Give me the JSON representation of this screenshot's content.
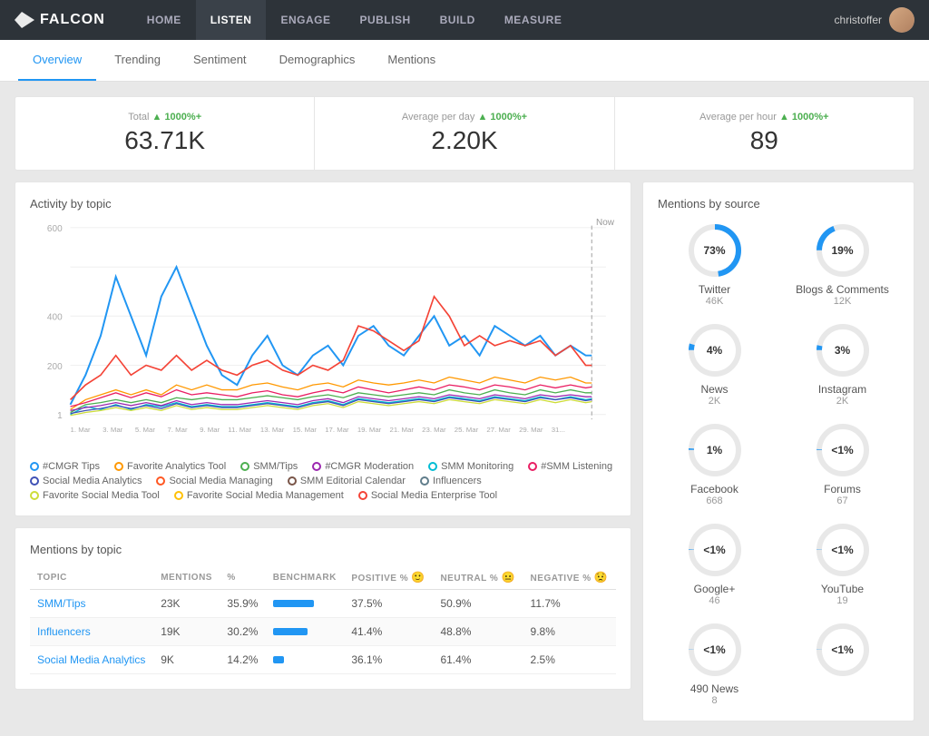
{
  "brand": {
    "name": "FALCON"
  },
  "nav": {
    "links": [
      {
        "id": "home",
        "label": "HOME",
        "active": false
      },
      {
        "id": "listen",
        "label": "LISTEN",
        "active": true
      },
      {
        "id": "engage",
        "label": "ENGAGE",
        "active": false
      },
      {
        "id": "publish",
        "label": "PUBLISH",
        "active": false
      },
      {
        "id": "build",
        "label": "BUILD",
        "active": false
      },
      {
        "id": "measure",
        "label": "MEASURE",
        "active": false
      }
    ],
    "user": "christoffer"
  },
  "subtabs": [
    {
      "id": "overview",
      "label": "Overview",
      "active": true
    },
    {
      "id": "trending",
      "label": "Trending",
      "active": false
    },
    {
      "id": "sentiment",
      "label": "Sentiment",
      "active": false
    },
    {
      "id": "demographics",
      "label": "Demographics",
      "active": false
    },
    {
      "id": "mentions",
      "label": "Mentions",
      "active": false
    }
  ],
  "stats": [
    {
      "id": "total",
      "label": "Total",
      "trend": "▲ 1000%+",
      "value": "63.71K"
    },
    {
      "id": "avg-per-day",
      "label": "Average per day",
      "trend": "▲ 1000%+",
      "value": "2.20K"
    },
    {
      "id": "avg-per-hour",
      "label": "Average per hour",
      "trend": "▲ 1000%+",
      "value": "89"
    }
  ],
  "activity_chart": {
    "title": "Activity by topic",
    "y_labels": [
      "600",
      "400",
      "200",
      "1"
    ],
    "x_labels": [
      "1. Mar",
      "3. Mar",
      "5. Mar",
      "7. Mar",
      "9. Mar",
      "11. Mar",
      "13. Mar",
      "15. Mar",
      "17. Mar",
      "19. Mar",
      "21. Mar",
      "23. Mar",
      "25. Mar",
      "27. Mar",
      "29. Mar",
      "31..."
    ],
    "now_label": "Now",
    "legend": [
      {
        "label": "#CMGR Tips",
        "color": "#2196f3"
      },
      {
        "label": "Favorite Analytics Tool",
        "color": "#ff9800"
      },
      {
        "label": "SMM/Tips",
        "color": "#4caf50"
      },
      {
        "label": "#CMGR Moderation",
        "color": "#9c27b0"
      },
      {
        "label": "SMM Monitoring",
        "color": "#00bcd4"
      },
      {
        "label": "#SMM Listening",
        "color": "#e91e63"
      },
      {
        "label": "Social Media Analytics",
        "color": "#3f51b5"
      },
      {
        "label": "Social Media Managing",
        "color": "#ff5722"
      },
      {
        "label": "SMM Editorial Calendar",
        "color": "#795548"
      },
      {
        "label": "Influencers",
        "color": "#607d8b"
      },
      {
        "label": "Favorite Social Media Tool",
        "color": "#cddc39"
      },
      {
        "label": "Favorite Social Media Management",
        "color": "#ffc107"
      },
      {
        "label": "Social Media Enterprise Tool",
        "color": "#f44336"
      }
    ]
  },
  "mentions_by_source": {
    "title": "Mentions by source",
    "sources": [
      {
        "label": "Twitter",
        "count": "46K",
        "pct": "73%",
        "pct_num": 73,
        "color": "#2196f3"
      },
      {
        "label": "Blogs & Comments",
        "count": "12K",
        "pct": "19%",
        "pct_num": 19,
        "color": "#2196f3"
      },
      {
        "label": "News",
        "count": "2K",
        "pct": "4%",
        "pct_num": 4,
        "color": "#2196f3"
      },
      {
        "label": "Instagram",
        "count": "2K",
        "pct": "3%",
        "pct_num": 3,
        "color": "#2196f3"
      },
      {
        "label": "Facebook",
        "count": "668",
        "pct": "1%",
        "pct_num": 1,
        "color": "#2196f3"
      },
      {
        "label": "Forums",
        "count": "67",
        "pct": "<1%",
        "pct_num": 0.5,
        "color": "#2196f3"
      },
      {
        "label": "Google+",
        "count": "46",
        "pct": "<1%",
        "pct_num": 0.3,
        "color": "#2196f3"
      },
      {
        "label": "YouTube",
        "count": "19",
        "pct": "<1%",
        "pct_num": 0.2,
        "color": "#2196f3"
      },
      {
        "label": "490 News",
        "count": "8",
        "pct": "<1%",
        "pct_num": 0.1,
        "color": "#2196f3"
      },
      {
        "label": "",
        "count": "",
        "pct": "<1%",
        "pct_num": 0.1,
        "color": "#2196f3"
      }
    ]
  },
  "mentions_table": {
    "title": "Mentions by topic",
    "columns": [
      "TOPIC",
      "MENTIONS",
      "%",
      "BENCHMARK",
      "POSITIVE %",
      "NEUTRAL %",
      "NEGATIVE %"
    ],
    "rows": [
      {
        "topic": "SMM/Tips",
        "mentions": "23K",
        "pct": "35.9%",
        "bench_w": 45,
        "positive": "37.5%",
        "neutral": "50.9%",
        "negative": "11.7%"
      },
      {
        "topic": "Influencers",
        "mentions": "19K",
        "pct": "30.2%",
        "bench_w": 38,
        "positive": "41.4%",
        "neutral": "48.8%",
        "negative": "9.8%"
      },
      {
        "topic": "Social Media Analytics",
        "mentions": "9K",
        "pct": "14.2%",
        "bench_w": 12,
        "positive": "36.1%",
        "neutral": "61.4%",
        "negative": "2.5%"
      }
    ]
  }
}
